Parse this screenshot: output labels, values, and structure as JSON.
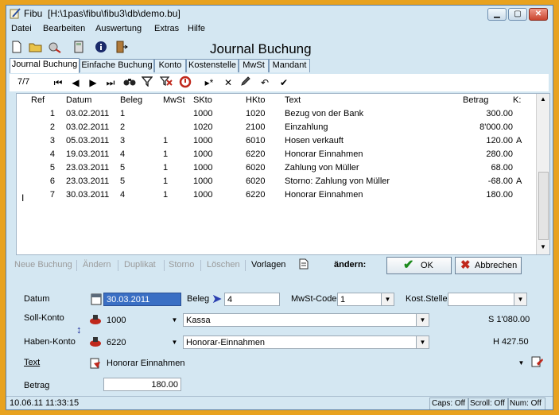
{
  "window": {
    "app": "Fibu",
    "path": "[H:\\1pas\\fibu\\fibu3\\db\\demo.bu]"
  },
  "menu": [
    "Datei",
    "Bearbeiten",
    "Auswertung",
    "Extras",
    "Hilfe"
  ],
  "toolbar": {
    "page_title": "Journal Buchung"
  },
  "tabs": [
    "Journal Buchung",
    "Einfache Buchung",
    "Konto",
    "Kostenstelle",
    "MwSt",
    "Mandant"
  ],
  "navigator": {
    "position": "7/7"
  },
  "grid": {
    "headers": {
      "ref": "Ref",
      "datum": "Datum",
      "beleg": "Beleg",
      "mwst": "MwSt",
      "skto": "SKto",
      "hkto": "HKto",
      "text": "Text",
      "betrag": "Betrag",
      "k": "K:"
    },
    "rows": [
      {
        "ref": "1",
        "datum": "03.02.2011",
        "beleg": "1",
        "mwst": "",
        "skto": "1000",
        "hkto": "1020",
        "text": "Bezug von der Bank",
        "betrag": "300.00",
        "k": ""
      },
      {
        "ref": "2",
        "datum": "03.02.2011",
        "beleg": "2",
        "mwst": "",
        "skto": "1020",
        "hkto": "2100",
        "text": "Einzahlung",
        "betrag": "8'000.00",
        "k": ""
      },
      {
        "ref": "3",
        "datum": "05.03.2011",
        "beleg": "3",
        "mwst": "1",
        "skto": "1000",
        "hkto": "6010",
        "text": "Hosen verkauft",
        "betrag": "120.00",
        "k": "A"
      },
      {
        "ref": "4",
        "datum": "19.03.2011",
        "beleg": "4",
        "mwst": "1",
        "skto": "1000",
        "hkto": "6220",
        "text": "Honorar Einnahmen",
        "betrag": "280.00",
        "k": ""
      },
      {
        "ref": "5",
        "datum": "23.03.2011",
        "beleg": "5",
        "mwst": "1",
        "skto": "1000",
        "hkto": "6020",
        "text": "Zahlung von Müller",
        "betrag": "68.00",
        "k": ""
      },
      {
        "ref": "6",
        "datum": "23.03.2011",
        "beleg": "5",
        "mwst": "1",
        "skto": "1000",
        "hkto": "6020",
        "text": "Storno: Zahlung von Müller",
        "betrag": "-68.00",
        "k": "A"
      },
      {
        "ref": "7",
        "datum": "30.03.2011",
        "beleg": "4",
        "mwst": "1",
        "skto": "1000",
        "hkto": "6220",
        "text": "Honorar Einnahmen",
        "betrag": "180.00",
        "k": ""
      }
    ]
  },
  "actions": {
    "neue_buchung": "Neue Buchung",
    "aendern": "Ändern",
    "duplikat": "Duplikat",
    "storno": "Storno",
    "loeschen": "Löschen",
    "vorlagen": "Vorlagen",
    "mode_label": "ändern:",
    "ok": "OK",
    "abbrechen": "Abbrechen"
  },
  "form": {
    "datum_label": "Datum",
    "datum_value": "30.03.2011",
    "beleg_label": "Beleg",
    "beleg_value": "4",
    "mwst_label": "MwSt-Code",
    "mwst_value": "1",
    "kost_label": "Kost.Stelle",
    "kost_value": "",
    "soll_label": "Soll-Konto",
    "soll_value": "1000",
    "soll_name": "Kassa",
    "soll_saldo": "S 1'080.00",
    "haben_label": "Haben-Konto",
    "haben_value": "6220",
    "haben_name": "Honorar-Einnahmen",
    "haben_saldo": "H 427.50",
    "text_label": "Text",
    "text_value": "Honorar Einnahmen",
    "betrag_label": "Betrag",
    "betrag_value": "180.00"
  },
  "status": {
    "datetime": "10.06.11 11:33:15",
    "caps": "Caps: Off",
    "scroll": "Scroll: Off",
    "num": "Num: Off"
  },
  "colors": {
    "window_bg": "#d4e7f2",
    "frame": "#e8a21f",
    "selection": "#3a6fc4",
    "ok_green": "#1c8a1c",
    "cancel_red": "#c0281c"
  }
}
